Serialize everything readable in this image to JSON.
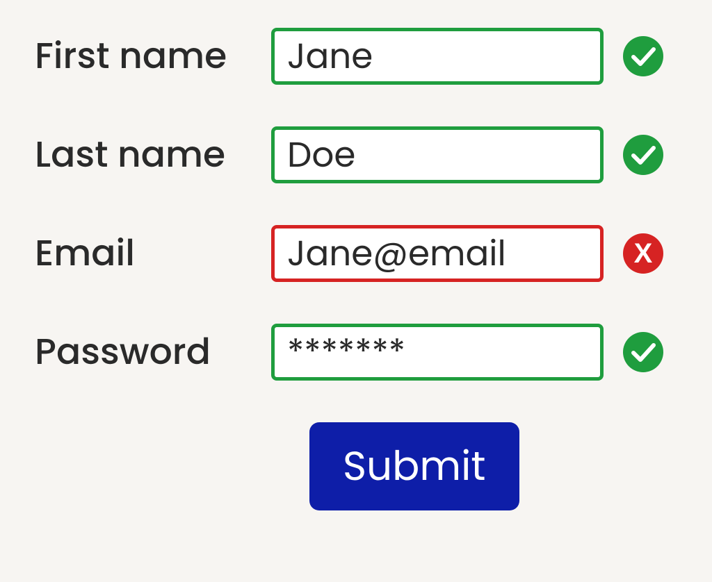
{
  "colors": {
    "valid": "#1f9d3e",
    "invalid": "#d62323",
    "submit_bg": "#0e1ea8"
  },
  "fields": {
    "first_name": {
      "label": "First name",
      "value": "Jane",
      "valid": true
    },
    "last_name": {
      "label": "Last name",
      "value": "Doe",
      "valid": true
    },
    "email": {
      "label": "Email",
      "value": "Jane@email",
      "valid": false
    },
    "password": {
      "label": "Password",
      "value": "*******",
      "valid": true
    }
  },
  "submit_label": "Submit"
}
